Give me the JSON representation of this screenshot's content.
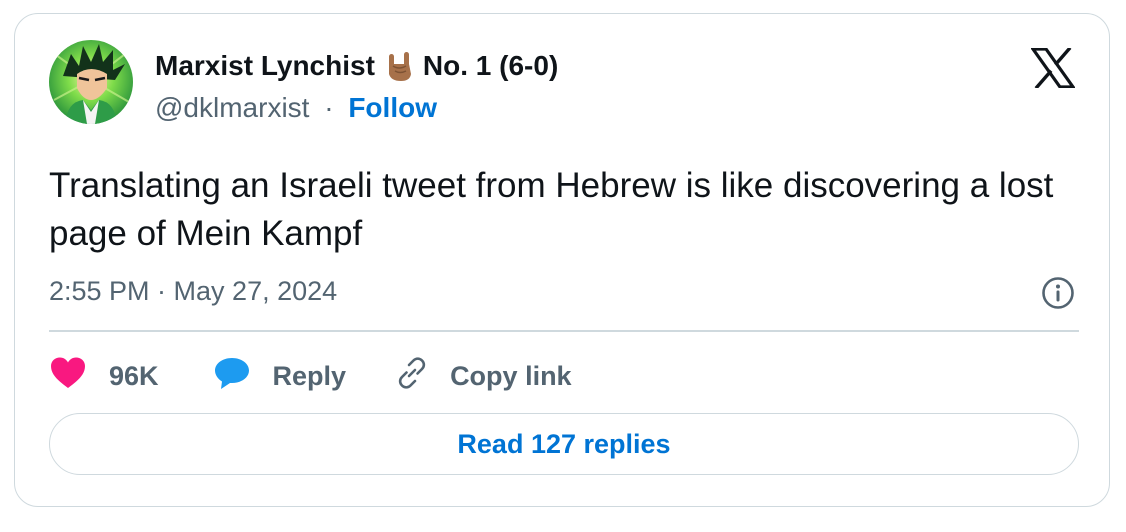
{
  "author": {
    "display_name": "Marxist Lynchist",
    "name_suffix": "No. 1 (6-0)",
    "handle": "@dklmarxist",
    "separator": "·",
    "follow_label": "Follow"
  },
  "tweet": {
    "text": "Translating an Israeli tweet from Hebrew is like discovering a lost page of Mein Kampf",
    "timestamp": "2:55 PM · May 27, 2024"
  },
  "actions": {
    "like_count": "96K",
    "reply_label": "Reply",
    "copy_link_label": "Copy link"
  },
  "read_replies_label": "Read 127 replies",
  "icons": {
    "avatar": "goku-avatar",
    "name_emoji": "rock-on-hand-emoji",
    "brand": "x-logo-icon",
    "info": "info-icon",
    "like": "heart-icon",
    "reply": "speech-bubble-icon",
    "copy": "link-icon"
  },
  "colors": {
    "text": "#0f1419",
    "secondary": "#536471",
    "accent": "#0074d4",
    "like": "#f91880",
    "reply_bubble": "#1d9bf0",
    "border": "#cfd9de"
  }
}
